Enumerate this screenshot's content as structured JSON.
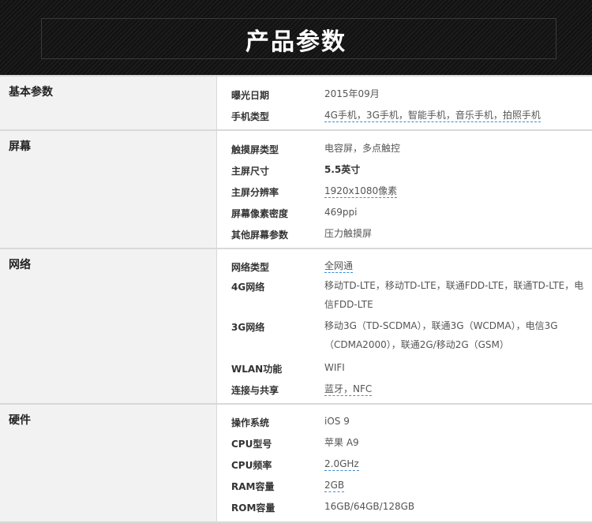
{
  "header": {
    "title": "产品参数"
  },
  "sections": [
    {
      "name": "基本参数",
      "rows": [
        {
          "key": "曝光日期",
          "value": "2015年09月"
        },
        {
          "key": "手机类型",
          "value": "4G手机，3G手机，智能手机，音乐手机，拍照手机"
        }
      ]
    },
    {
      "name": "屏幕",
      "rows": [
        {
          "key": "触摸屏类型",
          "value": "电容屏，多点触控"
        },
        {
          "key": "主屏尺寸",
          "value": "5.5英寸"
        },
        {
          "key": "主屏分辨率",
          "value": "1920x1080像素"
        },
        {
          "key": "屏幕像素密度",
          "value": "469ppi"
        },
        {
          "key": "其他屏幕参数",
          "value": "压力触摸屏"
        }
      ]
    },
    {
      "name": "网络",
      "rows": [
        {
          "key": "网络类型",
          "value": "全网通"
        },
        {
          "key": "4G网络",
          "value": "移动TD-LTE，移动TD-LTE，联通FDD-LTE，联通TD-LTE，电信FDD-LTE"
        },
        {
          "key": "3G网络",
          "value": "移动3G（TD-SCDMA），联通3G（WCDMA），电信3G（CDMA2000），联通2G/移动2G（GSM）"
        },
        {
          "key": "WLAN功能",
          "value": "WIFI"
        },
        {
          "key": "连接与共享",
          "value": "蓝牙，NFC"
        }
      ]
    },
    {
      "name": "硬件",
      "rows": [
        {
          "key": "操作系统",
          "value": "iOS 9"
        },
        {
          "key": "CPU型号",
          "value": "苹果 A9"
        },
        {
          "key": "CPU频率",
          "value": "2.0GHz"
        },
        {
          "key": "RAM容量",
          "value": "2GB"
        },
        {
          "key": "ROM容量",
          "value": "16GB/64GB/128GB"
        }
      ]
    }
  ]
}
